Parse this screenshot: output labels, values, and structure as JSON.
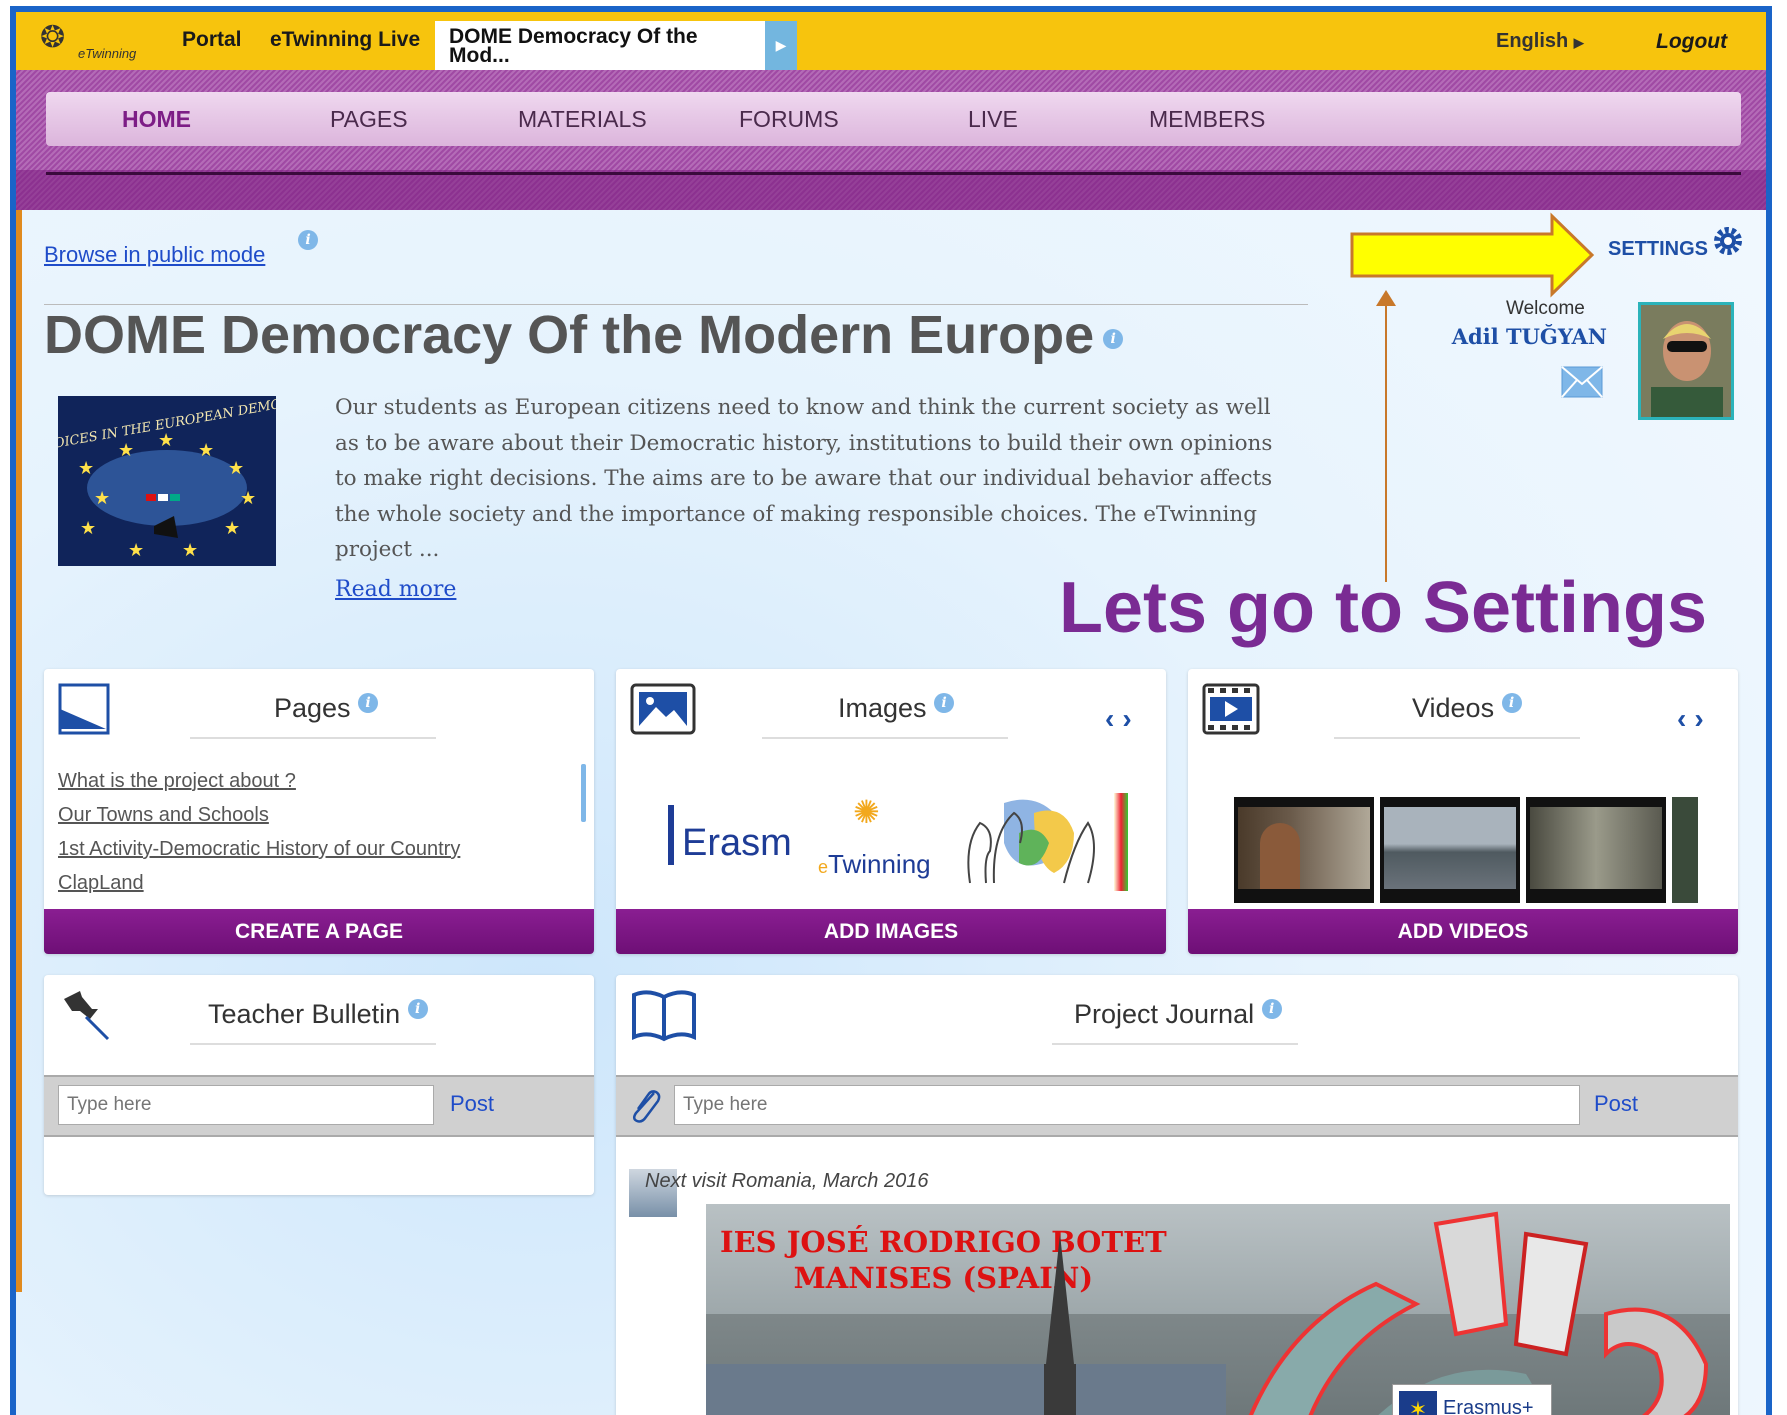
{
  "topbar": {
    "logo_text": "eTwinning",
    "portal": "Portal",
    "live": "eTwinning Live",
    "project_tab": "DOME Democracy Of the Mod...",
    "language": "English",
    "logout": "Logout"
  },
  "nav": {
    "items": [
      "HOME",
      "PAGES",
      "MATERIALS",
      "FORUMS",
      "LIVE",
      "MEMBERS"
    ],
    "active": "HOME"
  },
  "browse_public": "Browse in public mode",
  "settings": "SETTINGS",
  "project": {
    "title": "DOME Democracy Of the Modern Europe",
    "image_text": "YOUNG VOICES IN THE EUROPEAN DEMOCRACIES",
    "description": "Our students as European citizens need to know and think the current society as well as to be aware about their Democratic history, institutions to build their own opinions to make right decisions. The aims are to be aware that our individual behavior affects the whole society and the importance of making responsible choices. The eTwinning project ...",
    "read_more": "Read more"
  },
  "user": {
    "welcome": "Welcome",
    "name": "Adil TUĞYAN"
  },
  "annotation": "Lets go to Settings",
  "cards": {
    "pages": {
      "title": "Pages",
      "links": [
        "What is the project about ?",
        "Our Towns and Schools",
        "1st Activity-Democratic History of our Country",
        "ClapLand"
      ],
      "button": "CREATE A PAGE"
    },
    "images": {
      "title": "Images",
      "thumb_erasmus": "Erasm",
      "thumb_etwinning_e": "e",
      "thumb_etwinning": "Twinning",
      "button": "ADD IMAGES"
    },
    "videos": {
      "title": "Videos",
      "button": "ADD VIDEOS"
    },
    "bulletin": {
      "title": "Teacher Bulletin",
      "placeholder": "Type here",
      "post": "Post"
    },
    "journal": {
      "title": "Project Journal",
      "placeholder": "Type here",
      "post": "Post",
      "entry_title": "Next visit Romania, March 2016",
      "image_line1": "IES JOSÉ RODRIGO BOTET",
      "image_line2": "MANISES (SPAIN)",
      "image_badge": "Erasmus+"
    }
  },
  "colors": {
    "topbar": "#f7c40d",
    "nav_purple": "#a04aa4",
    "button_purple": "#7a1582",
    "link_blue": "#1f4cc9",
    "annotation_purple": "#7a2b93",
    "arrow_yellow": "#ffff00"
  }
}
